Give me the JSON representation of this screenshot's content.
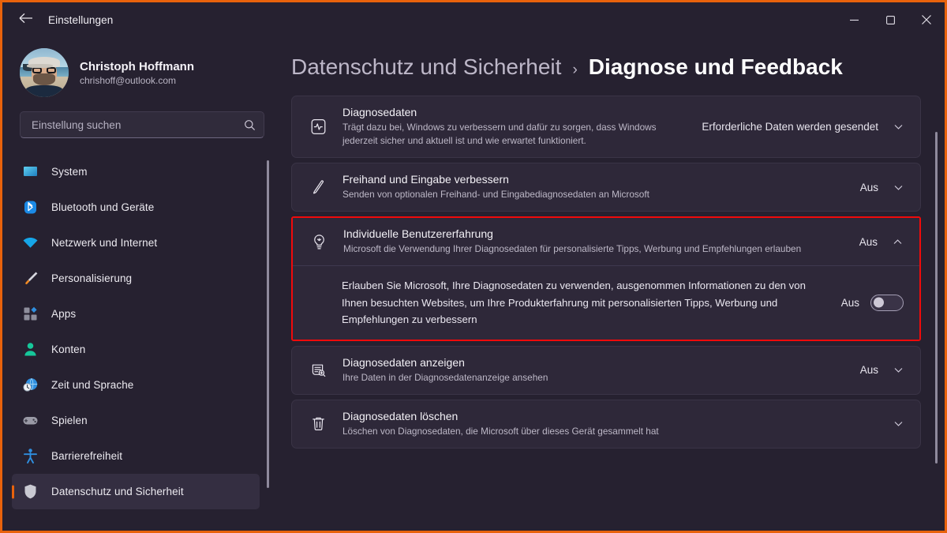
{
  "window": {
    "title": "Einstellungen",
    "back_icon": "arrow-left-icon",
    "minimize_label": "–",
    "maximize_label": "□",
    "close_label": "✕",
    "accent_color": "#e8620c",
    "highlight_color": "#f00a0a"
  },
  "account": {
    "name": "Christoph Hoffmann",
    "email": "chrishoff@outlook.com"
  },
  "search": {
    "placeholder": "Einstellung suchen",
    "value": "",
    "icon": "search-icon"
  },
  "sidebar": {
    "items": [
      {
        "label": "System",
        "icon": "monitor-icon",
        "selected": false
      },
      {
        "label": "Bluetooth und Geräte",
        "icon": "bluetooth-icon",
        "selected": false
      },
      {
        "label": "Netzwerk und Internet",
        "icon": "wifi-icon",
        "selected": false
      },
      {
        "label": "Personalisierung",
        "icon": "paintbrush-icon",
        "selected": false
      },
      {
        "label": "Apps",
        "icon": "apps-icon",
        "selected": false
      },
      {
        "label": "Konten",
        "icon": "person-icon",
        "selected": false
      },
      {
        "label": "Zeit und Sprache",
        "icon": "clock-globe-icon",
        "selected": false
      },
      {
        "label": "Spielen",
        "icon": "gamepad-icon",
        "selected": false
      },
      {
        "label": "Barrierefreiheit",
        "icon": "accessibility-icon",
        "selected": false
      },
      {
        "label": "Datenschutz und Sicherheit",
        "icon": "shield-icon",
        "selected": true
      }
    ]
  },
  "breadcrumb": {
    "parent": "Datenschutz und Sicherheit",
    "separator": "›",
    "current": "Diagnose und Feedback"
  },
  "cards": [
    {
      "icon": "pulse-icon",
      "title": "Diagnosedaten",
      "desc": "Trägt dazu bei, Windows zu verbessern und dafür zu sorgen, dass Windows jederzeit sicher und aktuell ist und wie erwartet funktioniert.",
      "value": "Erforderliche Daten werden gesendet",
      "chevron": "chevron-down-icon"
    },
    {
      "icon": "pen-icon",
      "title": "Freihand und Eingabe verbessern",
      "desc": "Senden von optionalen Freihand- und Eingabediagnosedaten an Microsoft",
      "value": "Aus",
      "chevron": "chevron-down-icon"
    }
  ],
  "highlighted": {
    "header": {
      "icon": "lightbulb-icon",
      "title": "Individuelle Benutzererfahrung",
      "desc": "Microsoft die Verwendung Ihrer Diagnosedaten für personalisierte Tipps, Werbung und Empfehlungen erlauben",
      "value": "Aus",
      "chevron": "chevron-up-icon"
    },
    "expanded": {
      "text": "Erlauben Sie Microsoft, Ihre Diagnosedaten zu verwenden, ausgenommen Informationen zu den von Ihnen besuchten Websites, um Ihre Produkterfahrung mit personalisierten Tipps, Werbung und Empfehlungen zu verbessern",
      "toggle_label": "Aus",
      "toggle_state": "off"
    }
  },
  "cards_after": [
    {
      "icon": "data-viewer-icon",
      "title": "Diagnosedaten anzeigen",
      "desc": "Ihre Daten in der Diagnosedatenanzeige ansehen",
      "value": "Aus",
      "chevron": "chevron-down-icon"
    },
    {
      "icon": "trash-icon",
      "title": "Diagnosedaten löschen",
      "desc": "Löschen von Diagnosedaten, die Microsoft über dieses Gerät gesammelt hat",
      "value": "",
      "chevron": "chevron-down-icon"
    }
  ]
}
